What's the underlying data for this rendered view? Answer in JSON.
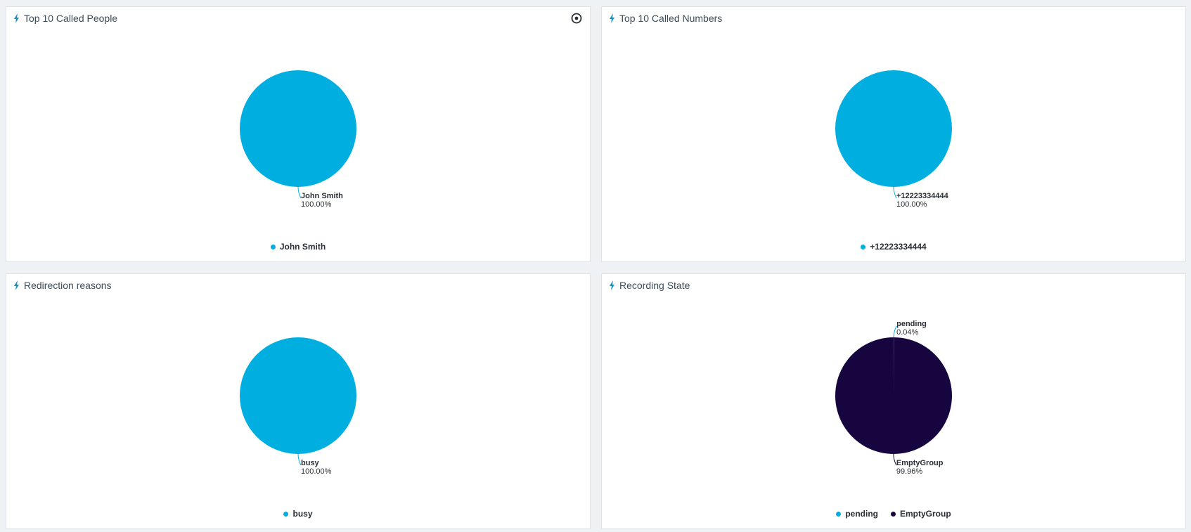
{
  "colors": {
    "cyan": "#00afe0",
    "navy": "#170540"
  },
  "panels": [
    {
      "title": "Top 10 Called People",
      "has_settings": true,
      "chart_data": {
        "type": "pie",
        "title": "Top 10 Called People",
        "slices": [
          {
            "label": "John Smith",
            "value": 100.0,
            "display": "100.00%",
            "color": "#00afe0"
          }
        ],
        "legend": "bottom"
      }
    },
    {
      "title": "Top 10 Called Numbers",
      "has_settings": false,
      "chart_data": {
        "type": "pie",
        "title": "Top 10 Called Numbers",
        "slices": [
          {
            "label": "+12223334444",
            "value": 100.0,
            "display": "100.00%",
            "color": "#00afe0"
          }
        ],
        "legend": "bottom"
      }
    },
    {
      "title": "Redirection reasons",
      "has_settings": false,
      "chart_data": {
        "type": "pie",
        "title": "Redirection reasons",
        "slices": [
          {
            "label": "busy",
            "value": 100.0,
            "display": "100.00%",
            "color": "#00afe0"
          }
        ],
        "legend": "bottom"
      }
    },
    {
      "title": "Recording State",
      "has_settings": false,
      "chart_data": {
        "type": "pie",
        "title": "Recording State",
        "slices": [
          {
            "label": "pending",
            "value": 0.04,
            "display": "0.04%",
            "color": "#00afe0"
          },
          {
            "label": "EmptyGroup",
            "value": 99.96,
            "display": "99.96%",
            "color": "#170540"
          }
        ],
        "legend": "bottom"
      }
    }
  ],
  "icons": {
    "panel_icon": "bolt-icon",
    "settings_icon": "gear-icon"
  }
}
